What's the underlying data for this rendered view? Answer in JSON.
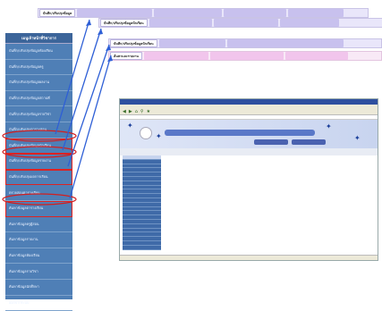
{
  "tabbars": [
    {
      "active": "บันทึก/ปรับปรุงข้อมูล",
      "inactive": [
        "",
        "",
        "",
        ""
      ]
    },
    {
      "active": "บันทึก/ปรับปรุงข้อมูลนักเรียน",
      "inactive": [
        "",
        "",
        ""
      ]
    },
    {
      "active": "บันทึก/ปรับปรุงข้อมูลนักเรียน",
      "inactive": [
        "",
        ""
      ]
    },
    {
      "active": "ค้นหาและรายงาน",
      "inactive": [
        "",
        "",
        ""
      ]
    }
  ],
  "sidebar": {
    "title": "เมนูเจ้าหน้าที่วิชาการ",
    "items": [
      "บันทึก/ปรับปรุงข้อมูลห้องเรียน",
      "บันทึก/ปรับปรุงข้อมูลครู",
      "บันทึก/ปรับปรุงข้อมูลผลงาน",
      "บันทึก/ปรับปรุงข้อมูลสถานที่",
      "บันทึก/ปรับปรุงข้อมูลรายวิชา",
      "บันทึก/ปรับปรุงตารางสอน",
      "บันทึก/ปรับปรุงข้อมูลนักเรียน",
      "บันทึก/ปรับปรุงข้อมูลรายงาน",
      "บันทึก/ปรับปรุงผลการเรียน",
      "ตรวจสอบตารางเรียน",
      "ค้นหาข้อมูลตารางเรียน",
      "ค้นหาข้อมูลครูผู้สอน",
      "ค้นหาข้อมูลรายงาน",
      "ค้นหาข้อมูลห้องเรียน",
      "ค้นหาข้อมูลรายวิชา",
      "ค้นหาข้อมูลนักศึกษา",
      "ออกจากระบบ"
    ]
  }
}
